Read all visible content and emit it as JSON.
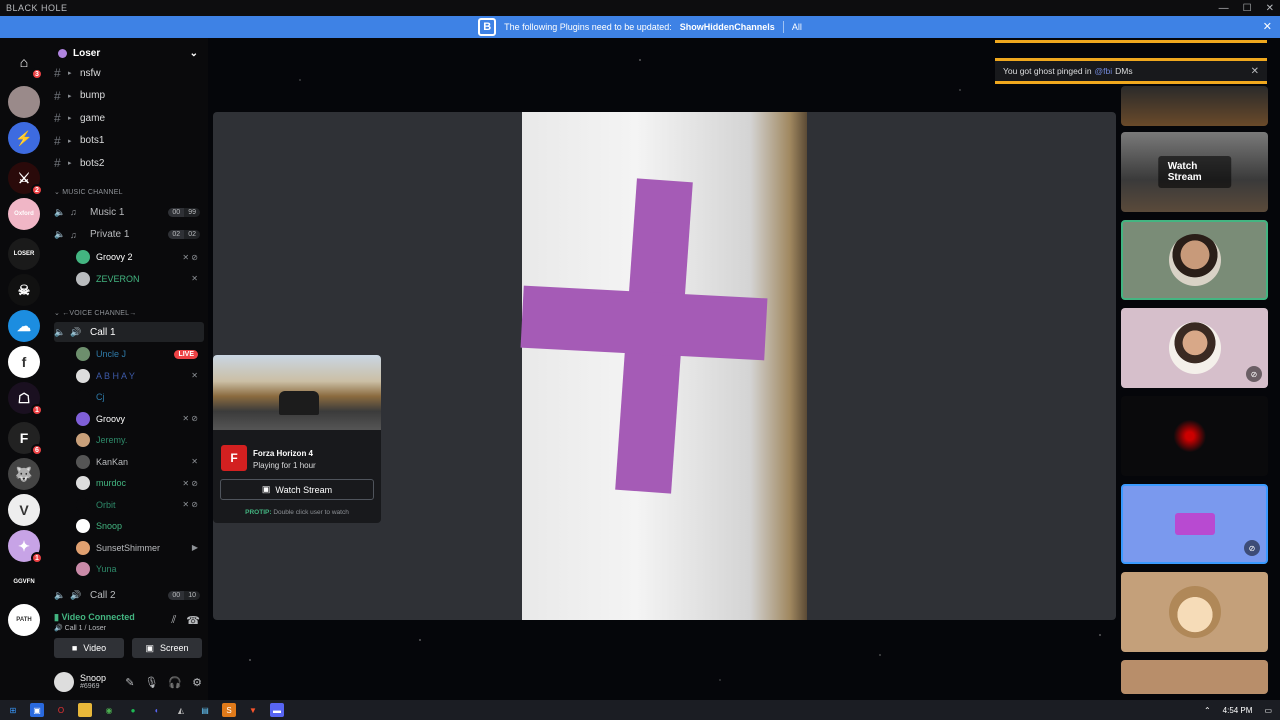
{
  "window": {
    "title": "BLACK HOLE",
    "controls": [
      "—",
      "☐",
      "✕"
    ]
  },
  "banner": {
    "logo": "B",
    "message": "The following Plugins need to be updated:",
    "plugin": "ShowHiddenChannels",
    "all_label": "All",
    "close": "✕"
  },
  "guilds": [
    {
      "name": "home-icon",
      "glyph": "⌂",
      "badge": "3",
      "color": "#0a0a0c"
    },
    {
      "name": "server-avatar-1",
      "glyph": "",
      "badge": "",
      "color": "#9a8a8a"
    },
    {
      "name": "server-shield",
      "glyph": "⚡",
      "badge": "",
      "color": "#3d6be0"
    },
    {
      "name": "server-red-logo",
      "glyph": "⚔",
      "badge": "2",
      "color": "#2a0a0a"
    },
    {
      "name": "server-oxford",
      "glyph": "Oxford",
      "badge": "",
      "color": "#f0b6c6"
    },
    {
      "name": "server-loser",
      "glyph": "LOSER",
      "badge": "",
      "color": "#1a1a1a"
    },
    {
      "name": "server-dark",
      "glyph": "☠",
      "badge": "",
      "color": "#111"
    },
    {
      "name": "server-cloud",
      "glyph": "☁",
      "badge": "",
      "color": "#1c8de0"
    },
    {
      "name": "server-f",
      "glyph": "f",
      "badge": "",
      "color": "#ffffff"
    },
    {
      "name": "server-red-figure",
      "glyph": "☖",
      "badge": "1",
      "color": "#1a1020"
    },
    {
      "name": "server-f-dark",
      "glyph": "F",
      "badge": "6",
      "color": "#222"
    },
    {
      "name": "server-wolf",
      "glyph": "🐺",
      "badge": "",
      "color": "#444"
    },
    {
      "name": "server-valorant",
      "glyph": "V",
      "badge": "",
      "color": "#eee"
    },
    {
      "name": "server-pony",
      "glyph": "✦",
      "badge": "1",
      "color": "#c7a3e6"
    },
    {
      "name": "server-ggvfn",
      "glyph": "GGVFN",
      "badge": "",
      "color": "#0a0a0c"
    },
    {
      "name": "server-path",
      "glyph": "PATH",
      "badge": "",
      "color": "#ffffff"
    }
  ],
  "server": {
    "name": "Loser"
  },
  "text_channels": [
    {
      "name": "nsfw"
    },
    {
      "name": "bump"
    },
    {
      "name": "game"
    },
    {
      "name": "bots1"
    },
    {
      "name": "bots2"
    }
  ],
  "categories": {
    "music": "MUSIC CHANNEL",
    "voice": "←VOICE CHANNEL→"
  },
  "music_channels": [
    {
      "name": "Music 1",
      "count_a": "00",
      "count_b": "99"
    },
    {
      "name": "Private 1",
      "count_a": "02",
      "count_b": "02"
    }
  ],
  "music_users": [
    {
      "name": "Groovy 2",
      "color": "#ffffff",
      "av": "#43b581",
      "icons": "✕ ⊘"
    },
    {
      "name": "ZEVERON",
      "color": "#43b581",
      "av": "#b9bbbe",
      "icons": "✕"
    }
  ],
  "voice_channel": {
    "name": "Call 1"
  },
  "voice_users": [
    {
      "name": "Uncle J",
      "color": "#2e7aa8",
      "av": "#6d8f6d",
      "icons": "",
      "live": "LIVE"
    },
    {
      "name": "A B H A Y",
      "color": "#3d5aa8",
      "av": "#ddd",
      "icons": "✕",
      "live": ""
    },
    {
      "name": "Cj",
      "color": "#2e7aa8",
      "av": "#0a0a0c",
      "icons": "",
      "live": ""
    },
    {
      "name": "Groovy",
      "color": "#ffffff",
      "av": "#7f5fd8",
      "icons": "✕ ⊘",
      "live": ""
    },
    {
      "name": "Jeremy.",
      "color": "#2e8a6a",
      "av": "#c9a07a",
      "icons": "",
      "live": ""
    },
    {
      "name": "KanKan",
      "color": "#b9bbbe",
      "av": "#555",
      "icons": "✕",
      "live": ""
    },
    {
      "name": "murdoc",
      "color": "#43b581",
      "av": "#ddd",
      "icons": "✕ ⊘",
      "live": ""
    },
    {
      "name": "Orbit",
      "color": "#2e8a6a",
      "av": "#0a0a0c",
      "icons": "✕ ⊘",
      "live": ""
    },
    {
      "name": "Snoop",
      "color": "#43b581",
      "av": "#ffffff",
      "icons": "",
      "live": ""
    },
    {
      "name": "SunsetShimmer",
      "color": "#b9bbbe",
      "av": "#e0a070",
      "icons": "▶",
      "live": ""
    },
    {
      "name": "Yuna",
      "color": "#2e8a6a",
      "av": "#c98aa8",
      "icons": "",
      "live": ""
    }
  ],
  "voice_channel_2": {
    "name": "Call 2",
    "count_a": "00",
    "count_b": "10"
  },
  "voice_panel": {
    "status": "Video Connected",
    "sub": "Call 1 / Loser",
    "video_label": "Video",
    "screen_label": "Screen"
  },
  "user_panel": {
    "name": "Snoop",
    "tag": "#6969"
  },
  "stream_popup": {
    "game": "Forza Horizon 4",
    "playing": "Playing for 1 hour",
    "watch_label": "Watch Stream",
    "protip_label": "PROTIP:",
    "protip_text": "Double click user to watch"
  },
  "toast": {
    "text_pre": "You got ghost pinged in",
    "mention": "@fbi",
    "text_post": "DMs",
    "close": "✕"
  },
  "tiles": {
    "watch_stream": "Watch Stream"
  },
  "taskbar": {
    "time": "4:54 PM"
  }
}
